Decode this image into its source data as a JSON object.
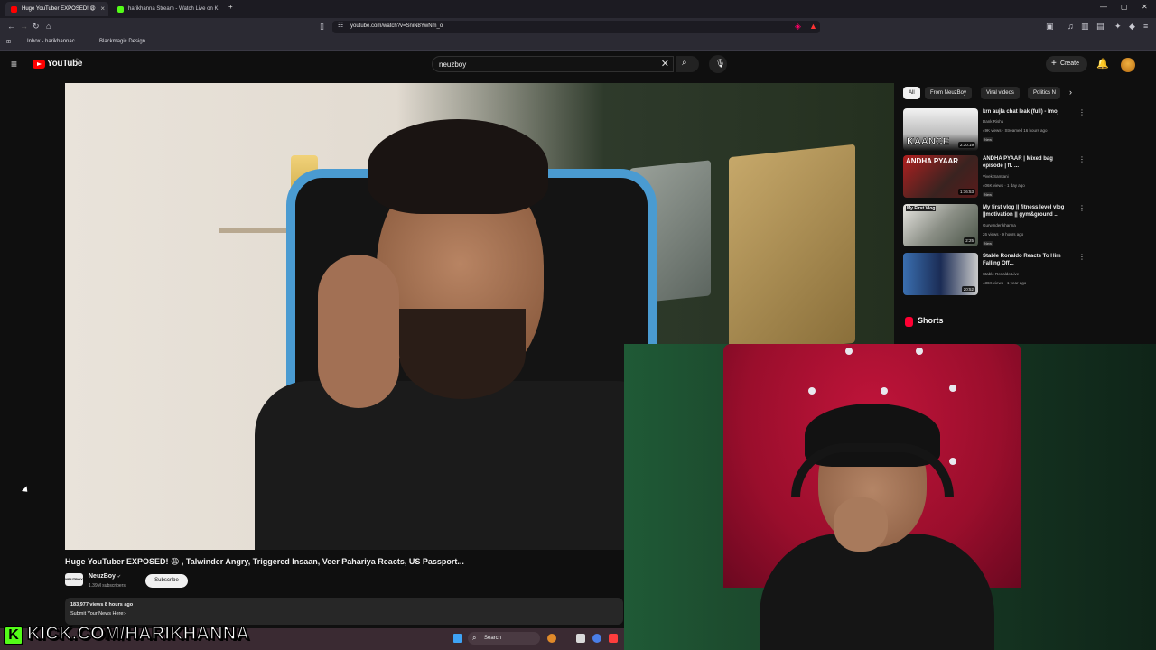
{
  "browser": {
    "tabs": [
      {
        "label": "Huge YouTuber EXPOSED! 😩"
      },
      {
        "label": "harikhanna Stream - Watch Live on K"
      }
    ],
    "new_tab_symbol": "+",
    "url": "youtube.com/watch?v=SniN8YwNm_o",
    "bookmarks": [
      "Inbox - harikhannac...",
      "Blackmagic Design..."
    ]
  },
  "youtube": {
    "logo_text": "YouTube",
    "country_code": "IN",
    "search_value": "neuzboy",
    "create_label": "Create",
    "video": {
      "title": "Huge YouTuber EXPOSED! 😩 , Talwinder Angry, Triggered Insaan, Veer Pahariya Reacts, US Passport...",
      "channel": "NeuzBoy",
      "channel_avatar_text": "NEUZBOY",
      "subscribers": "1.39M subscribers",
      "subscribe_label": "Subscribe",
      "views_time": "183,977 views  8 hours ago",
      "description": "Submit Your News Here:-"
    },
    "chips": [
      "All",
      "From NeuzBoy",
      "Viral videos",
      "Politics N"
    ],
    "recommendations": [
      {
        "title": "krn aujla chat leak (full) - lmoj",
        "channel": "Dank Rishu",
        "meta": "49K views · Streamed 16 hours ago",
        "badge": "New",
        "duration": "2:30:19",
        "thumb_text": "KAANCE"
      },
      {
        "title": "ANDHA PYAAR | Mixed bag episode | ft. ...",
        "channel": "Vivek Samtani",
        "meta": "406K views · 1 day ago",
        "badge": "New",
        "duration": "1:16:53",
        "thumb_text": "ANDHA PYAAR"
      },
      {
        "title": "My first vlog || fitness level vlog ||motivation || gym&ground ...",
        "channel": "Gurwinder khanna",
        "meta": "26 views · 9 hours ago",
        "badge": "New",
        "duration": "2:25",
        "thumb_text": "My First Vlog"
      },
      {
        "title": "Stable Ronaldo Reacts To Him Falling Off...",
        "channel": "Stable Ronaldo Live",
        "meta": "436K views · 1 year ago",
        "badge": "",
        "duration": "20:52",
        "thumb_text": ""
      }
    ],
    "shorts_label": "Shorts"
  },
  "taskbar": {
    "search_label": "Search"
  },
  "overlay": {
    "kick_text": "KICK.COM/HARIKHANNA",
    "kick_logo": "K"
  },
  "colors": {
    "youtube_red": "#ff0000",
    "kick_green": "#53fc18",
    "page_bg": "#0f0f0f"
  }
}
